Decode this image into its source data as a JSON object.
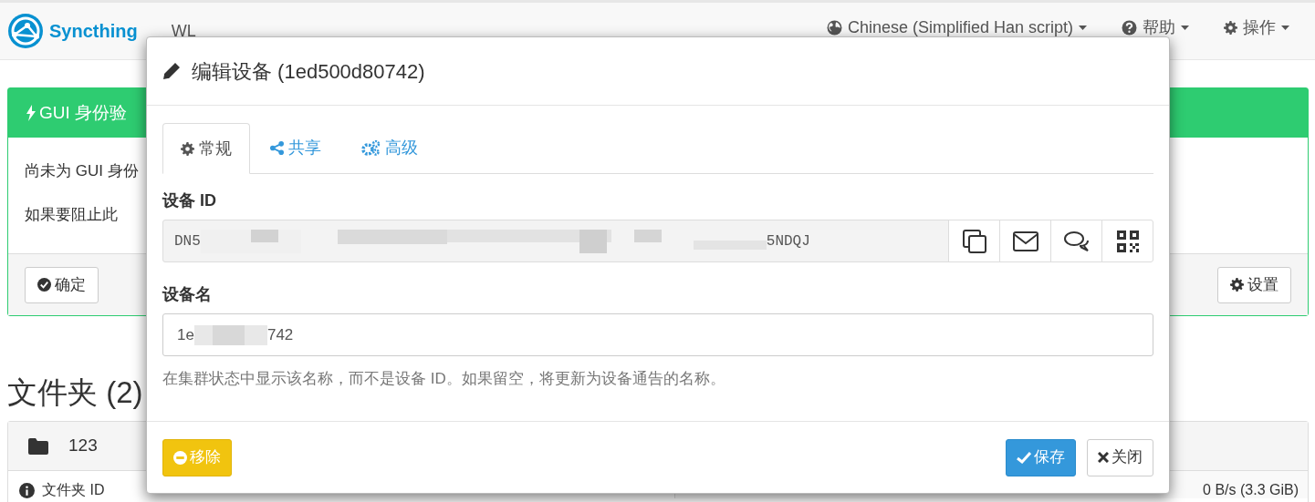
{
  "navbar": {
    "brand": "Syncthing",
    "device_name": "WL",
    "menus": [
      {
        "label": "Chinese (Simplified Han script)"
      },
      {
        "label": "帮助"
      },
      {
        "label": "操作"
      }
    ]
  },
  "notice_panel": {
    "title": "GUI 身份验",
    "lines": [
      "尚未为 GUI 身份",
      "如果要阻止此"
    ],
    "buttons": [
      "确定",
      "设置"
    ]
  },
  "folders": {
    "heading": "文件夹 (2)",
    "folder_name": "123",
    "left_row": {
      "label": "文件夹 ID"
    },
    "right_row": {
      "value": "0 B/s (3.3 GiB)"
    }
  },
  "dialog": {
    "title": "编辑设备 (1ed500d80742)",
    "tabs": [
      {
        "label": "常规",
        "selected": true
      },
      {
        "label": "共享",
        "selected": false
      },
      {
        "label": "高级",
        "selected": false
      }
    ],
    "device_id": {
      "label": "设备 ID",
      "value_start": "DN5",
      "value_end": "5NDQJ"
    },
    "device_name": {
      "label": "设备名",
      "value_start": "1e",
      "value_end": "742",
      "help": "在集群状态中显示该名称，而不是设备 ID。如果留空，将更新为设备通告的名称。"
    },
    "buttons": [
      {
        "kind": "remove",
        "label": "移除"
      },
      {
        "kind": "save",
        "label": "保存"
      },
      {
        "kind": "close",
        "label": "关闭"
      }
    ]
  }
}
